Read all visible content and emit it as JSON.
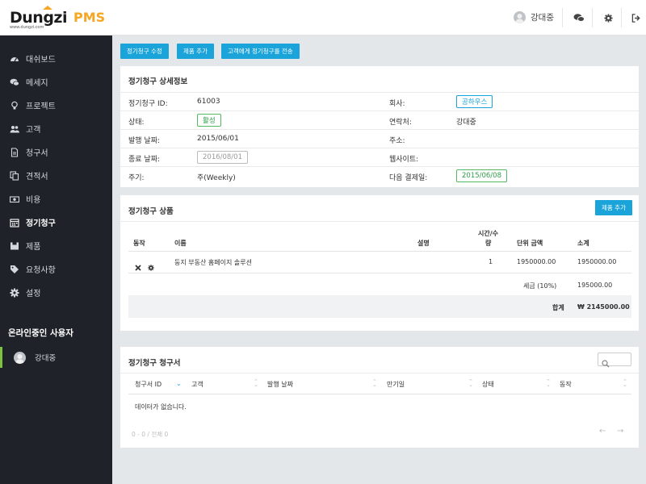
{
  "brand": {
    "logo_text": "Dungzi",
    "logo_sub": "www.dungzi.com",
    "product": "PMS",
    "accent": "#f5a623"
  },
  "sidebar": {
    "items": [
      {
        "label": "대쉬보드",
        "icon": "dashboard-icon"
      },
      {
        "label": "메세지",
        "icon": "chat-icon"
      },
      {
        "label": "프로젝트",
        "icon": "lightbulb-icon"
      },
      {
        "label": "고객",
        "icon": "users-icon"
      },
      {
        "label": "청구서",
        "icon": "file-icon"
      },
      {
        "label": "견적서",
        "icon": "copy-icon"
      },
      {
        "label": "비용",
        "icon": "money-icon"
      },
      {
        "label": "정기청구",
        "icon": "calendar-icon",
        "active": true
      },
      {
        "label": "제품",
        "icon": "product-icon"
      },
      {
        "label": "요청사항",
        "icon": "tag-icon"
      },
      {
        "label": "설정",
        "icon": "gear-icon"
      }
    ],
    "online_title": "온라인중인 사용자",
    "online_users": [
      "강대중"
    ]
  },
  "topbar": {
    "user_name": "강대중"
  },
  "actions": {
    "edit": "정기청구 수정",
    "add_product": "제품 추가",
    "send": "고객에게 정기청구를 전송"
  },
  "details": {
    "title": "정기청구 상세정보",
    "id_label": "정기청구 ID:",
    "id_value": "61003",
    "status_label": "상태:",
    "status_value": "활성",
    "issue_label": "발행 날짜:",
    "issue_value": "2015/06/01",
    "end_label": "종료 날짜:",
    "end_value": "2016/08/01",
    "cycle_label": "주기:",
    "cycle_value": "주(Weekly)",
    "company_label": "회사:",
    "company_value": "공하우스",
    "contact_label": "연락처:",
    "contact_value": "강대중",
    "address_label": "주소:",
    "address_value": "",
    "website_label": "웹사이트:",
    "website_value": "",
    "next_label": "다음 결제일:",
    "next_value": "2015/06/08"
  },
  "products": {
    "title": "정기청구 상품",
    "add_button": "제품 추가",
    "headers": {
      "action": "동작",
      "name": "이름",
      "desc": "설명",
      "qty_line1": "시간/수",
      "qty_line2": "량",
      "unit": "단위 금액",
      "subtotal": "소계"
    },
    "rows": [
      {
        "name": "둥지 부동산 홈페이지 솔루션",
        "desc": "",
        "qty": "1",
        "unit": "1950000.00",
        "subtotal": "1950000.00"
      }
    ],
    "tax_label": "세금 (10%)",
    "tax_value": "195000.00",
    "total_label": "합계",
    "total_value": "₩ 2145000.00"
  },
  "invoices": {
    "title": "정기청구 청구서",
    "headers": [
      "청구서 ID",
      "고객",
      "발행 날짜",
      "만기일",
      "상태",
      "동작"
    ],
    "empty": "데이터가 없습니다.",
    "pager": "0 - 0 / 전체 0"
  }
}
